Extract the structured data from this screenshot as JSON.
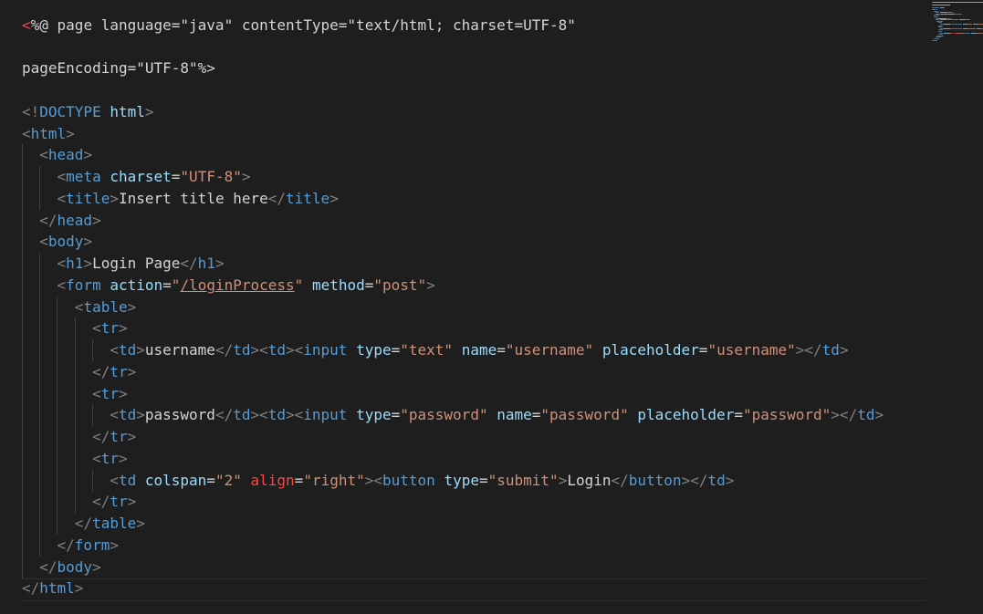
{
  "colors": {
    "background": "#1e1e1e",
    "bracket": "#808080",
    "tag": "#569cd6",
    "attribute": "#9cdcfe",
    "string": "#ce9178",
    "text": "#d4d4d4",
    "directive": "#f44747"
  },
  "code_lines": [
    [
      [
        "red",
        "<"
      ],
      [
        "text",
        "%@ page language=\"java\" contentType=\"text/html; charset=UTF-8\""
      ]
    ],
    [],
    [
      [
        "text",
        "pageEncoding=\"UTF-8\"%>"
      ]
    ],
    [],
    [
      [
        "bracket",
        "<!"
      ],
      [
        "tag",
        "DOCTYPE"
      ],
      [
        "text",
        " "
      ],
      [
        "attr",
        "html"
      ],
      [
        "bracket",
        ">"
      ]
    ],
    [
      [
        "bracket",
        "<"
      ],
      [
        "tag",
        "html"
      ],
      [
        "bracket",
        ">"
      ]
    ],
    [
      [
        "text",
        "  "
      ],
      [
        "bracket",
        "<"
      ],
      [
        "tag",
        "head"
      ],
      [
        "bracket",
        ">"
      ]
    ],
    [
      [
        "text",
        "    "
      ],
      [
        "bracket",
        "<"
      ],
      [
        "tag",
        "meta"
      ],
      [
        "text",
        " "
      ],
      [
        "attr",
        "charset"
      ],
      [
        "text",
        "="
      ],
      [
        "string",
        "\"UTF-8\""
      ],
      [
        "bracket",
        ">"
      ]
    ],
    [
      [
        "text",
        "    "
      ],
      [
        "bracket",
        "<"
      ],
      [
        "tag",
        "title"
      ],
      [
        "bracket",
        ">"
      ],
      [
        "text",
        "Insert title here"
      ],
      [
        "bracket",
        "</"
      ],
      [
        "tag",
        "title"
      ],
      [
        "bracket",
        ">"
      ]
    ],
    [
      [
        "text",
        "  "
      ],
      [
        "bracket",
        "</"
      ],
      [
        "tag",
        "head"
      ],
      [
        "bracket",
        ">"
      ]
    ],
    [
      [
        "text",
        "  "
      ],
      [
        "bracket",
        "<"
      ],
      [
        "tag",
        "body"
      ],
      [
        "bracket",
        ">"
      ]
    ],
    [
      [
        "text",
        "    "
      ],
      [
        "bracket",
        "<"
      ],
      [
        "tag",
        "h1"
      ],
      [
        "bracket",
        ">"
      ],
      [
        "text",
        "Login Page"
      ],
      [
        "bracket",
        "</"
      ],
      [
        "tag",
        "h1"
      ],
      [
        "bracket",
        ">"
      ]
    ],
    [
      [
        "text",
        "    "
      ],
      [
        "bracket",
        "<"
      ],
      [
        "tag",
        "form"
      ],
      [
        "text",
        " "
      ],
      [
        "attr",
        "action"
      ],
      [
        "text",
        "="
      ],
      [
        "string",
        "\""
      ],
      [
        "link",
        "/loginProcess"
      ],
      [
        "string",
        "\""
      ],
      [
        "text",
        " "
      ],
      [
        "attr",
        "method"
      ],
      [
        "text",
        "="
      ],
      [
        "string",
        "\"post\""
      ],
      [
        "bracket",
        ">"
      ]
    ],
    [
      [
        "text",
        "      "
      ],
      [
        "bracket",
        "<"
      ],
      [
        "tag",
        "table"
      ],
      [
        "bracket",
        ">"
      ]
    ],
    [
      [
        "text",
        "        "
      ],
      [
        "bracket",
        "<"
      ],
      [
        "tag",
        "tr"
      ],
      [
        "bracket",
        ">"
      ]
    ],
    [
      [
        "text",
        "          "
      ],
      [
        "bracket",
        "<"
      ],
      [
        "tag",
        "td"
      ],
      [
        "bracket",
        ">"
      ],
      [
        "text",
        "username"
      ],
      [
        "bracket",
        "</"
      ],
      [
        "tag",
        "td"
      ],
      [
        "bracket",
        "><"
      ],
      [
        "tag",
        "td"
      ],
      [
        "bracket",
        "><"
      ],
      [
        "tag",
        "input"
      ],
      [
        "text",
        " "
      ],
      [
        "attr",
        "type"
      ],
      [
        "text",
        "="
      ],
      [
        "string",
        "\"text\""
      ],
      [
        "text",
        " "
      ],
      [
        "attr",
        "name"
      ],
      [
        "text",
        "="
      ],
      [
        "string",
        "\"username\""
      ],
      [
        "text",
        " "
      ],
      [
        "attr",
        "placeholder"
      ],
      [
        "text",
        "="
      ],
      [
        "string",
        "\"username\""
      ],
      [
        "bracket",
        "></"
      ],
      [
        "tag",
        "td"
      ],
      [
        "bracket",
        ">"
      ]
    ],
    [
      [
        "text",
        "        "
      ],
      [
        "bracket",
        "</"
      ],
      [
        "tag",
        "tr"
      ],
      [
        "bracket",
        ">"
      ]
    ],
    [
      [
        "text",
        "        "
      ],
      [
        "bracket",
        "<"
      ],
      [
        "tag",
        "tr"
      ],
      [
        "bracket",
        ">"
      ]
    ],
    [
      [
        "text",
        "          "
      ],
      [
        "bracket",
        "<"
      ],
      [
        "tag",
        "td"
      ],
      [
        "bracket",
        ">"
      ],
      [
        "text",
        "password"
      ],
      [
        "bracket",
        "</"
      ],
      [
        "tag",
        "td"
      ],
      [
        "bracket",
        "><"
      ],
      [
        "tag",
        "td"
      ],
      [
        "bracket",
        "><"
      ],
      [
        "tag",
        "input"
      ],
      [
        "text",
        " "
      ],
      [
        "attr",
        "type"
      ],
      [
        "text",
        "="
      ],
      [
        "string",
        "\"password\""
      ],
      [
        "text",
        " "
      ],
      [
        "attr",
        "name"
      ],
      [
        "text",
        "="
      ],
      [
        "string",
        "\"password\""
      ],
      [
        "text",
        " "
      ],
      [
        "attr",
        "placeholder"
      ],
      [
        "text",
        "="
      ],
      [
        "string",
        "\"password\""
      ],
      [
        "bracket",
        "></"
      ],
      [
        "tag",
        "td"
      ],
      [
        "bracket",
        ">"
      ]
    ],
    [
      [
        "text",
        "        "
      ],
      [
        "bracket",
        "</"
      ],
      [
        "tag",
        "tr"
      ],
      [
        "bracket",
        ">"
      ]
    ],
    [
      [
        "text",
        "        "
      ],
      [
        "bracket",
        "<"
      ],
      [
        "tag",
        "tr"
      ],
      [
        "bracket",
        ">"
      ]
    ],
    [
      [
        "text",
        "          "
      ],
      [
        "bracket",
        "<"
      ],
      [
        "tag",
        "td"
      ],
      [
        "text",
        " "
      ],
      [
        "attr",
        "colspan"
      ],
      [
        "text",
        "="
      ],
      [
        "string",
        "\"2\""
      ],
      [
        "text",
        " "
      ],
      [
        "red",
        "align"
      ],
      [
        "text",
        "="
      ],
      [
        "string",
        "\"right\""
      ],
      [
        "bracket",
        "><"
      ],
      [
        "tag",
        "button"
      ],
      [
        "text",
        " "
      ],
      [
        "attr",
        "type"
      ],
      [
        "text",
        "="
      ],
      [
        "string",
        "\"submit\""
      ],
      [
        "bracket",
        ">"
      ],
      [
        "text",
        "Login"
      ],
      [
        "bracket",
        "</"
      ],
      [
        "tag",
        "button"
      ],
      [
        "bracket",
        "></"
      ],
      [
        "tag",
        "td"
      ],
      [
        "bracket",
        ">"
      ]
    ],
    [
      [
        "text",
        "        "
      ],
      [
        "bracket",
        "</"
      ],
      [
        "tag",
        "tr"
      ],
      [
        "bracket",
        ">"
      ]
    ],
    [
      [
        "text",
        "      "
      ],
      [
        "bracket",
        "</"
      ],
      [
        "tag",
        "table"
      ],
      [
        "bracket",
        ">"
      ]
    ],
    [
      [
        "text",
        "    "
      ],
      [
        "bracket",
        "</"
      ],
      [
        "tag",
        "form"
      ],
      [
        "bracket",
        ">"
      ]
    ],
    [
      [
        "text",
        "  "
      ],
      [
        "bracket",
        "</"
      ],
      [
        "tag",
        "body"
      ],
      [
        "bracket",
        ">"
      ]
    ],
    [
      [
        "bracket",
        "</"
      ],
      [
        "tag",
        "html"
      ],
      [
        "bracket",
        ">"
      ]
    ]
  ]
}
